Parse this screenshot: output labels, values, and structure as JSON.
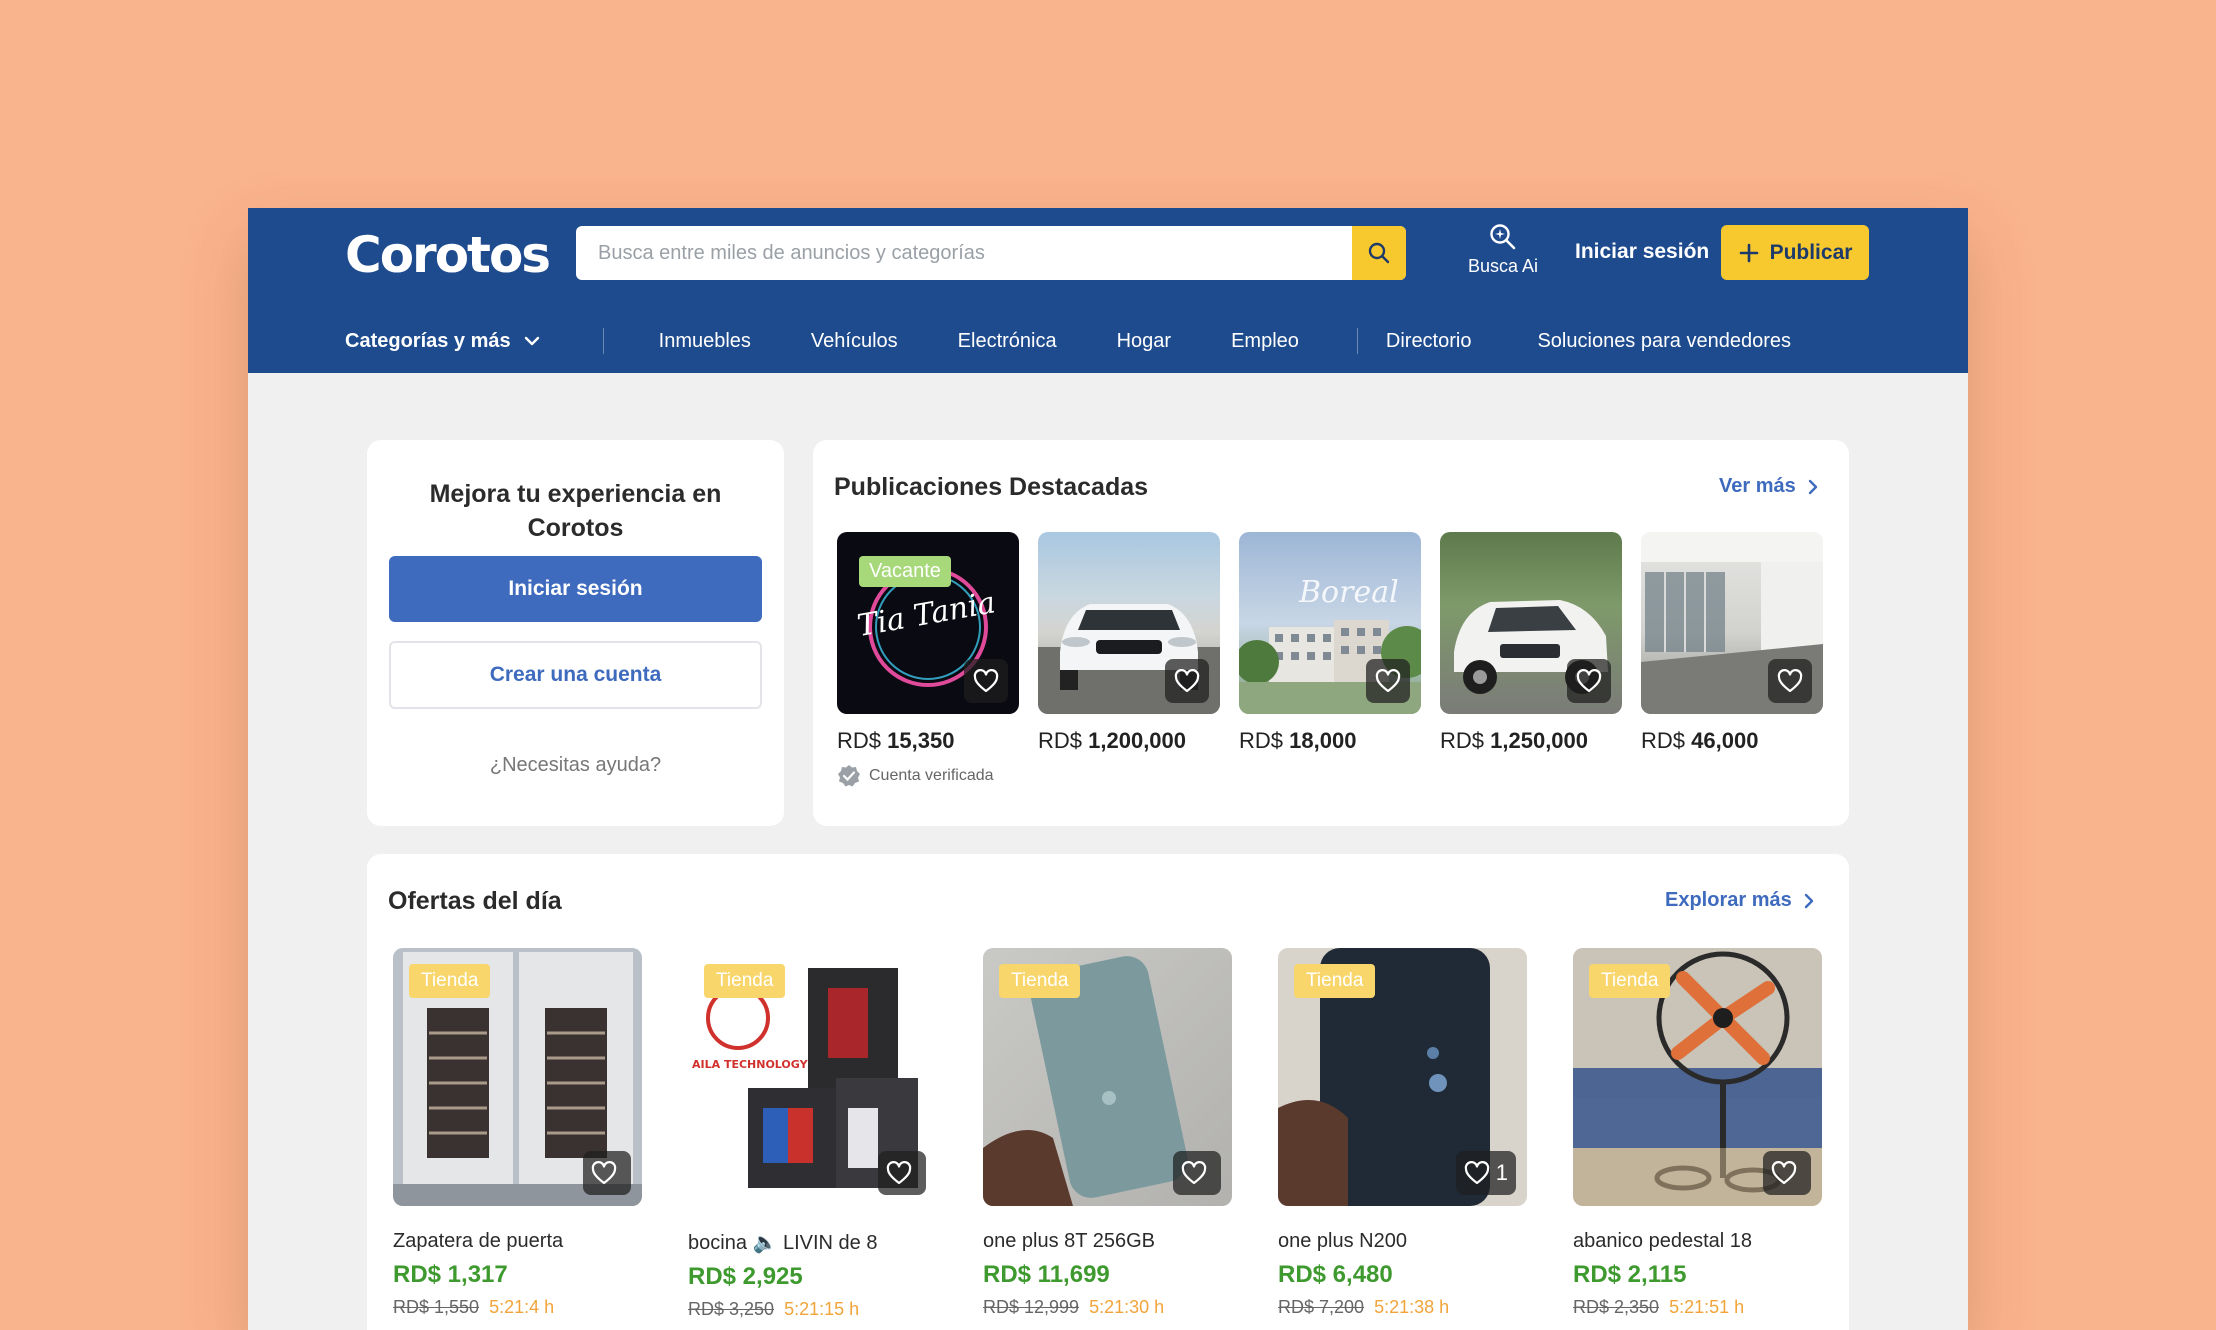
{
  "brand": {
    "logo": "Corotos",
    "primary": "#1E4B8E",
    "accent": "#F8C92E",
    "background": "#F9B38D"
  },
  "header": {
    "search_placeholder": "Busca entre miles de anuncios y categorías",
    "busca_ai": "Busca Ai",
    "login": "Iniciar sesión",
    "publish": "Publicar"
  },
  "nav": {
    "categories": "Categorías y más",
    "items": [
      "Inmuebles",
      "Vehículos",
      "Electrónica",
      "Hogar",
      "Empleo",
      "Directorio",
      "Soluciones para vendedores"
    ]
  },
  "login_panel": {
    "title": "Mejora tu experiencia en Corotos",
    "login": "Iniciar sesión",
    "create": "Crear una cuenta",
    "help": "¿Necesitas ayuda?"
  },
  "featured": {
    "title": "Publicaciones Destacadas",
    "more": "Ver más",
    "items": [
      {
        "currency": "RD$",
        "price": "15,350",
        "badge": "Vacante",
        "image_text": "Tia Tania",
        "verified": "Cuenta verificada"
      },
      {
        "currency": "RD$",
        "price": "1,200,000"
      },
      {
        "currency": "RD$",
        "price": "18,000",
        "image_text": "Boreal"
      },
      {
        "currency": "RD$",
        "price": "1,250,000"
      },
      {
        "currency": "RD$",
        "price": "46,000"
      }
    ]
  },
  "offers": {
    "title": "Ofertas del día",
    "more": "Explorar más",
    "items": [
      {
        "badge": "Tienda",
        "title": "Zapatera de puerta",
        "price": "RD$ 1,317",
        "old_price": "RD$ 1,550",
        "time": "5:21:4 h",
        "likes": ""
      },
      {
        "badge": "Tienda",
        "title": "bocina 🔈 LIVIN de 8",
        "price": "RD$ 2,925",
        "old_price": "RD$ 3,250",
        "time": "5:21:15 h",
        "likes": "",
        "image_text": "AILA TECHNOLOGY"
      },
      {
        "badge": "Tienda",
        "title": "one plus 8T 256GB",
        "price": "RD$ 11,699",
        "old_price": "RD$ 12,999",
        "time": "5:21:30 h",
        "likes": ""
      },
      {
        "badge": "Tienda",
        "title": "one plus N200",
        "price": "RD$ 6,480",
        "old_price": "RD$ 7,200",
        "time": "5:21:38 h",
        "likes": "1"
      },
      {
        "badge": "Tienda",
        "title": "abanico pedestal 18",
        "price": "RD$ 2,115",
        "old_price": "RD$ 2,350",
        "time": "5:21:51 h",
        "likes": ""
      }
    ]
  }
}
